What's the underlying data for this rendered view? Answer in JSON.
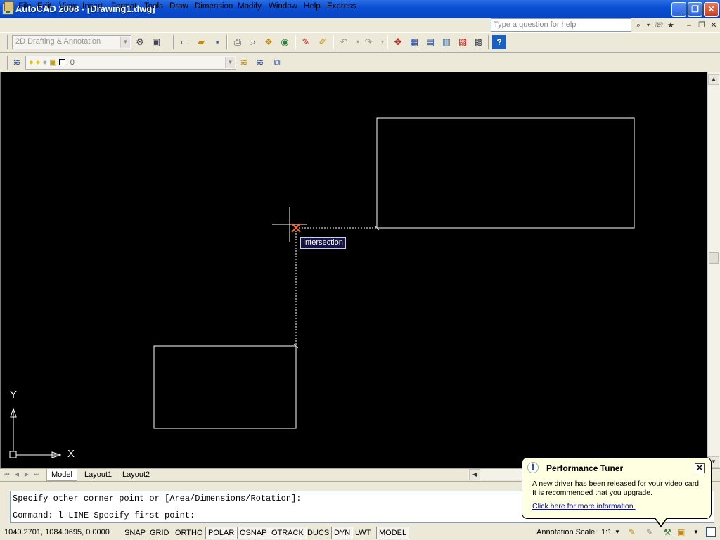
{
  "window": {
    "title": "AutoCAD 2008 - [Drawing1.dwg]",
    "controls": {
      "minimize": "_",
      "maximize": "❐",
      "close": "✕"
    }
  },
  "menu": {
    "items": [
      "File",
      "Edit",
      "View",
      "Insert",
      "Format",
      "Tools",
      "Draw",
      "Dimension",
      "Modify",
      "Window",
      "Help",
      "Express"
    ],
    "help_search_placeholder": "Type a question for help",
    "doc_controls": {
      "minimize": "–",
      "restore": "❐",
      "close": "✕"
    }
  },
  "toolbar": {
    "workspace": "2D Drafting & Annotation",
    "layer_value": "0"
  },
  "drawing": {
    "tooltip": "Intersection",
    "ucs": {
      "x_label": "X",
      "y_label": "Y"
    }
  },
  "tabs": {
    "items": [
      "Model",
      "Layout1",
      "Layout2"
    ],
    "active": "Model"
  },
  "command": {
    "line1": "Specify other corner point or [Area/Dimensions/Rotation]:",
    "line2": "Command: l LINE Specify first point:"
  },
  "status": {
    "coordinates": "1040.2701, 1084.0695, 0.0000",
    "toggles": [
      {
        "label": "SNAP",
        "on": false
      },
      {
        "label": "GRID",
        "on": false
      },
      {
        "label": "ORTHO",
        "on": false
      },
      {
        "label": "POLAR",
        "on": true
      },
      {
        "label": "OSNAP",
        "on": true
      },
      {
        "label": "OTRACK",
        "on": true
      },
      {
        "label": "DUCS",
        "on": false
      },
      {
        "label": "DYN",
        "on": true
      },
      {
        "label": "LWT",
        "on": false
      },
      {
        "label": "MODEL",
        "on": true
      }
    ],
    "annotation_scale_label": "Annotation Scale:",
    "annotation_scale_value": "1:1"
  },
  "balloon": {
    "title": "Performance Tuner",
    "line1": "A new driver has been released for your video card.",
    "line2": "It is recommended that you upgrade.",
    "link": "Click here for more information.",
    "close": "✕"
  },
  "colors": {
    "canvas": "#000000",
    "drawing_lines": "#ffffff",
    "titlebar": "#0a4fd4",
    "tooltip_bg": "#141444"
  }
}
